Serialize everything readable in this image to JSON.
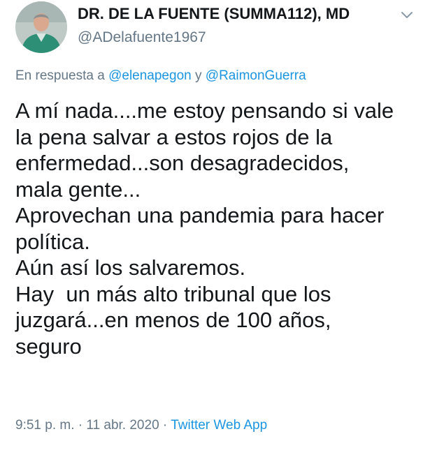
{
  "author": {
    "display_name": "DR. DE LA FUENTE (SUMMA112), MD",
    "handle": "@ADelafuente1967"
  },
  "reply": {
    "prefix": "En respuesta a",
    "mention_1": "@elenapegon",
    "connector": "y",
    "mention_2": "@RaimonGuerra"
  },
  "tweet": {
    "lines": [
      "A mí nada....me estoy pensando si vale",
      "la pena salvar a estos rojos de la",
      "enfermedad...son desagradecidos,",
      "mala gente...",
      "Aprovechan una pandemia para hacer",
      "política.",
      "Aún así los salvaremos.",
      "Hay  un más alto tribunal que los",
      "juzgará...en menos de 100 años,",
      "seguro"
    ]
  },
  "meta": {
    "time": "9:51 p. m.",
    "separator": "·",
    "date": "11 abr. 2020",
    "app": "Twitter Web App"
  },
  "icons": {
    "avatar": "profile-photo",
    "caret": "chevron-down-icon"
  },
  "colors": {
    "text": "#14171a",
    "secondary": "#657786",
    "link": "#1b95e0"
  }
}
